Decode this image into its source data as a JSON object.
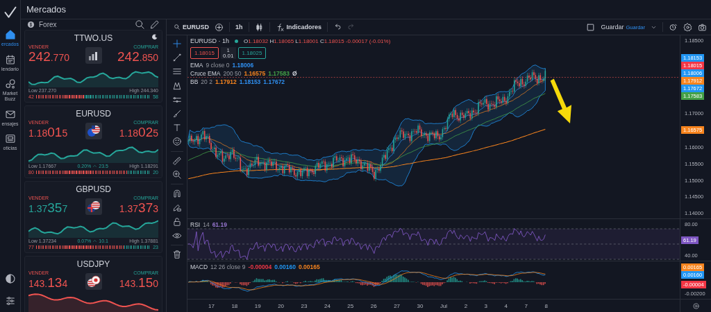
{
  "header": {
    "title": "Mercados"
  },
  "nav": {
    "items": [
      {
        "label": "ercados",
        "selected": true
      },
      {
        "label": "lendario",
        "selected": false
      },
      {
        "label": "Market Buzz",
        "selected": false
      },
      {
        "label": "ensajes",
        "selected": false
      },
      {
        "label": "oticias",
        "selected": false
      }
    ]
  },
  "markets": {
    "category": "Forex",
    "cards": [
      {
        "symbol": "TTWO.US",
        "sell_label": "VENDER",
        "buy_label": "COMPRAR",
        "sell": {
          "color": "#ef5350",
          "parts": [
            {
              "text": "242",
              "large": true
            },
            {
              "text": ".770",
              "large": false
            }
          ]
        },
        "buy": {
          "color": "#ef5350",
          "parts": [
            {
              "text": "242",
              "large": true
            },
            {
              "text": ".850",
              "large": false
            }
          ]
        },
        "sparkline": {
          "color": "#26a69a",
          "rising": true
        },
        "low": "Low 237.270",
        "high": "High 244.340",
        "sentiment": {
          "sell": "42",
          "buy": "58",
          "level": 0.42
        }
      },
      {
        "symbol": "EURUSD",
        "sell_label": "VENDER",
        "buy_label": "COMPRAR",
        "sell": {
          "color": "#ef5350",
          "parts": [
            {
              "text": "1.18",
              "large": false
            },
            {
              "text": "01",
              "large": true
            },
            {
              "text": "5",
              "large": false
            }
          ]
        },
        "buy": {
          "color": "#ef5350",
          "parts": [
            {
              "text": "1.18",
              "large": false
            },
            {
              "text": "02",
              "large": true
            },
            {
              "text": "5",
              "large": false
            }
          ]
        },
        "sparkline": {
          "color": "#26a69a",
          "rising": true
        },
        "low": "Low 1.17667",
        "change": "0.20%",
        "pips": "23.5",
        "high": "High 1.18291",
        "sentiment": {
          "sell": "80",
          "buy": "20",
          "level": 0.8
        }
      },
      {
        "symbol": "GBPUSD",
        "sell_label": "VENDER",
        "buy_label": "COMPRAR",
        "sell": {
          "color": "#26a69a",
          "parts": [
            {
              "text": "1.37",
              "large": false
            },
            {
              "text": "35",
              "large": true
            },
            {
              "text": "7",
              "large": false
            }
          ]
        },
        "buy": {
          "color": "#ef5350",
          "parts": [
            {
              "text": "1.37",
              "large": false
            },
            {
              "text": "37",
              "large": true
            },
            {
              "text": "3",
              "large": false
            }
          ]
        },
        "sparkline": {
          "color": "#26a69a",
          "rising": true
        },
        "low": "Low 1.37234",
        "change": "0.07%",
        "pips": "10.1",
        "high": "High 1.37881",
        "sentiment": {
          "sell": "77",
          "buy": "23",
          "level": 0.77
        }
      },
      {
        "symbol": "USDJPY",
        "sell_label": "VENDER",
        "buy_label": "COMPRAR",
        "sell": {
          "color": "#ef5350",
          "parts": [
            {
              "text": "143.",
              "large": false
            },
            {
              "text": "13",
              "large": true
            },
            {
              "text": "4",
              "large": false
            }
          ]
        },
        "buy": {
          "color": "#ef5350",
          "parts": [
            {
              "text": "143.",
              "large": false
            },
            {
              "text": "15",
              "large": true
            },
            {
              "text": "0",
              "large": false
            }
          ]
        },
        "sparkline": {
          "color": "#ef5350",
          "rising": false
        }
      }
    ]
  },
  "chart": {
    "toolbar": {
      "symbol": "EURUSD",
      "interval": "1h",
      "indicators": "Indicadores",
      "history": [
        {
          "kind": "undo",
          "disabled": false
        },
        {
          "kind": "redo",
          "disabled": true
        }
      ],
      "save": "Guardar",
      "save_status": "Guardar"
    },
    "legend": {
      "title": "EURUSD · 1h",
      "ohlc": [
        {
          "label": "O",
          "value": "1.18032"
        },
        {
          "label": "H",
          "value": "1.18065"
        },
        {
          "label": "L",
          "value": "1.18001"
        },
        {
          "label": "C",
          "value": "1.18015"
        }
      ],
      "change": "-0.00017 (-0.01%)"
    },
    "trade": {
      "sell": "1.18015",
      "lots_label": "1",
      "lots": "0.01",
      "buy": "1.18025"
    },
    "indicators": [
      {
        "name": "EMA",
        "params": "9 close 0",
        "values": [
          {
            "text": "1.18006",
            "color": "#2f8ff0"
          }
        ]
      },
      {
        "name": "Cruce EMA",
        "params": "200 50",
        "values": [
          {
            "text": "1.16575",
            "color": "#f7841e"
          },
          {
            "text": "1.17583",
            "color": "#43a047"
          },
          {
            "text": "Ø",
            "color": "#d1d4dc"
          }
        ]
      },
      {
        "name": "BB",
        "params": "20 2",
        "values": [
          {
            "text": "1.17912",
            "color": "#f7841e"
          },
          {
            "text": "1.18153",
            "color": "#2f8ff0"
          },
          {
            "text": "1.17672",
            "color": "#2f8ff0"
          }
        ]
      }
    ],
    "price_axis": [
      {
        "kind": "tick",
        "text": "1.18500"
      },
      {
        "kind": "badges",
        "items": [
          {
            "text": "1.18153",
            "color": "#2196f3"
          },
          {
            "text": "1.18015",
            "color": "#f23645"
          },
          {
            "text": "1.18006",
            "color": "#2196f3"
          },
          {
            "text": "1.17912",
            "color": "#f7841e"
          },
          {
            "text": "1.17672",
            "color": "#2196f3"
          },
          {
            "text": "1.17583",
            "color": "#43a047"
          }
        ]
      },
      {
        "kind": "tick",
        "text": "1.17000"
      },
      {
        "kind": "badges",
        "items": [
          {
            "text": "1.16575",
            "color": "#f7841e"
          }
        ]
      },
      {
        "kind": "tick",
        "text": "1.16000"
      },
      {
        "kind": "tick",
        "text": "1.15500"
      },
      {
        "kind": "tick",
        "text": "1.15000"
      },
      {
        "kind": "tick",
        "text": "1.14500"
      },
      {
        "kind": "tick",
        "text": "1.14000"
      }
    ],
    "rsi": {
      "name": "RSI",
      "params": "14",
      "values": [
        {
          "text": "61.19",
          "color": "#9575cd"
        }
      ],
      "axis": [
        {
          "kind": "tick",
          "text": "80.00"
        },
        {
          "kind": "badges",
          "items": [
            {
              "text": "61.19",
              "color": "#7e57c2"
            }
          ]
        },
        {
          "kind": "tick",
          "text": "40.00"
        }
      ]
    },
    "macd": {
      "name": "MACD",
      "params": "12 26 close 9",
      "values": [
        {
          "text": "-0.00004",
          "color": "#f23645"
        },
        {
          "text": "0.00160",
          "color": "#2196f3"
        },
        {
          "text": "0.00165",
          "color": "#f7841e"
        }
      ],
      "axis": [
        {
          "kind": "badges",
          "items": [
            {
              "text": "0.00165",
              "color": "#f7841e"
            },
            {
              "text": "0.00160",
              "color": "#2196f3"
            }
          ]
        },
        {
          "kind": "badges",
          "items": [
            {
              "text": "-0.00004",
              "color": "#f23645"
            }
          ]
        },
        {
          "kind": "tick",
          "text": "-0.00200"
        }
      ]
    },
    "time_axis": [
      "17",
      "18",
      "19",
      "20",
      "23",
      "24",
      "25",
      "26",
      "27",
      "30",
      "Jul",
      "2",
      "3",
      "4",
      "7",
      "8"
    ]
  }
}
